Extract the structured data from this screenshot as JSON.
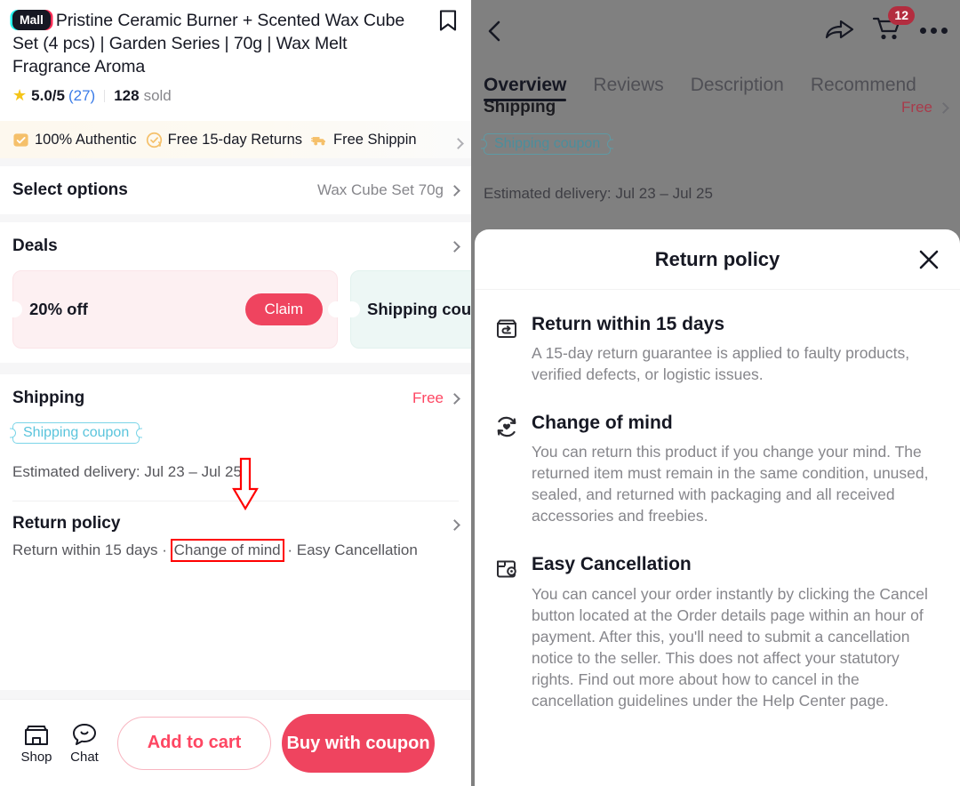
{
  "product": {
    "badge": "Mall",
    "title": "Pristine Ceramic Burner + Scented Wax Cube Set (4 pcs) | Garden Series | 70g | Wax Melt Fragrance Aroma",
    "bookmark_icon": "bookmark-icon",
    "rating": "5.0",
    "rating_denominator": "/5",
    "rating_count": "(27)",
    "sold_count": "128",
    "sold_label": "sold"
  },
  "guarantee_badges": [
    {
      "label": "100% Authentic",
      "icon": "authentic-box-icon"
    },
    {
      "label": "Free 15-day Returns",
      "icon": "returns-circle-icon"
    },
    {
      "label": "Free Shippin",
      "icon": "shipping-truck-icon"
    }
  ],
  "select_options": {
    "title": "Select options",
    "value": "Wax Cube Set 70g"
  },
  "deals": {
    "title": "Deals",
    "coupons": [
      {
        "label": "20% off",
        "action": "Claim",
        "type": "discount"
      },
      {
        "label": "Shipping coup",
        "type": "shipping"
      }
    ]
  },
  "shipping": {
    "title": "Shipping",
    "value": "Free",
    "coupon_chip": "Shipping coupon",
    "delivery": "Estimated delivery: Jul 23 – Jul 25"
  },
  "return_policy_row": {
    "title": "Return policy",
    "summary_parts": [
      "Return within 15 days",
      "Change of mind",
      "Easy Cancellation"
    ],
    "summary_prefix": "Return within 15 days ·",
    "summary_highlight": "Change of mind",
    "summary_suffix": "· Easy Cancellation",
    "highlight_color": "#ff0000"
  },
  "bottom_bar": {
    "shop_label": "Shop",
    "shop_icon": "storefront-icon",
    "chat_label": "Chat",
    "chat_icon": "chat-bubble-icon",
    "add_to_cart": "Add to cart",
    "buy_with_coupon": "Buy with coupon"
  },
  "right_panel": {
    "back_icon": "back-chevron-icon",
    "share_icon": "share-arrow-icon",
    "cart_icon": "shopping-cart-icon",
    "cart_badge": "12",
    "more_icon": "more-dots-icon",
    "tabs": [
      {
        "label": "Overview",
        "active": true
      },
      {
        "label": "Reviews",
        "active": false
      },
      {
        "label": "Description",
        "active": false
      },
      {
        "label": "Recommend",
        "active": false
      }
    ],
    "underlay": {
      "shipping_title": "Shipping",
      "shipping_value": "Free",
      "coupon_chip": "Shipping coupon",
      "delivery": "Estimated delivery: Jul 23 – Jul 25"
    }
  },
  "modal": {
    "title": "Return policy",
    "close_icon": "close-icon",
    "sections": [
      {
        "icon": "return-box-icon",
        "heading": "Return within 15 days",
        "body": "A 15-day return guarantee is applied to faulty products, verified defects, or logistic issues."
      },
      {
        "icon": "change-of-mind-heart-refresh-icon",
        "heading": "Change of mind",
        "body": "You can return this product if you change your mind. The returned item must remain in the same condition, unused, sealed, and returned with packaging and all received accessories and freebies."
      },
      {
        "icon": "easy-cancellation-icon",
        "heading": "Easy Cancellation",
        "body": "You can cancel your order instantly by clicking the Cancel button located at the Order details page within an hour of payment. After this, you'll need to submit a cancellation notice to the seller. This does not affect your statutory rights. Find out more about how to cancel in the cancellation guidelines under the Help Center page."
      }
    ]
  },
  "colors": {
    "brand_red": "#ef445f",
    "accent_pink": "#fe4662",
    "coupon_cyan": "#5ac4dc",
    "annotation_red": "#ff0000",
    "dim_overlay": "#808080"
  }
}
